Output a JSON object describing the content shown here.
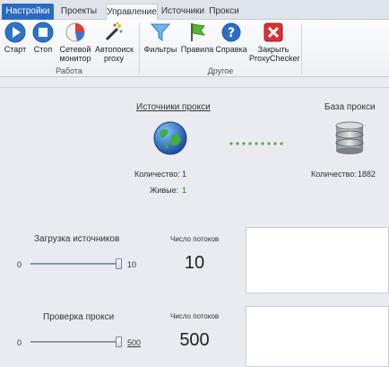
{
  "tabs": [
    "Настройки",
    "Проекты",
    "Управление",
    "Источники",
    "Прокси"
  ],
  "ribbon": {
    "buttons": {
      "start": "Старт",
      "stop": "Стоп",
      "monitor": "Сетевой монитор",
      "autosearch": "Автопоиск proxy",
      "filters": "Фильтры",
      "rules": "Правила",
      "help": "Справка",
      "close": "Закрыть ProxyChecker"
    },
    "groups": {
      "work": "Работа",
      "other": "Другое"
    }
  },
  "main": {
    "sources_link": "Источники прокси",
    "db_title": "База прокси",
    "count_label": "Количество:",
    "sources_count": "1",
    "alive_label": "Живые:",
    "alive_count": "1",
    "db_count": "1882"
  },
  "load": {
    "title": "Загрузка источников",
    "threads_label": "Число потоков",
    "threads": "10",
    "min": "0",
    "max": "10",
    "level": 1.0
  },
  "check": {
    "title": "Проверка прокси",
    "threads_label": "Число потоков",
    "threads": "500",
    "min": "0",
    "max": "500",
    "level": 1.0
  },
  "colors": {
    "accent": "#2a6bc2",
    "link": "#1f4fa8",
    "alive": "#1a7a1a",
    "dots": "#5aa82a"
  }
}
